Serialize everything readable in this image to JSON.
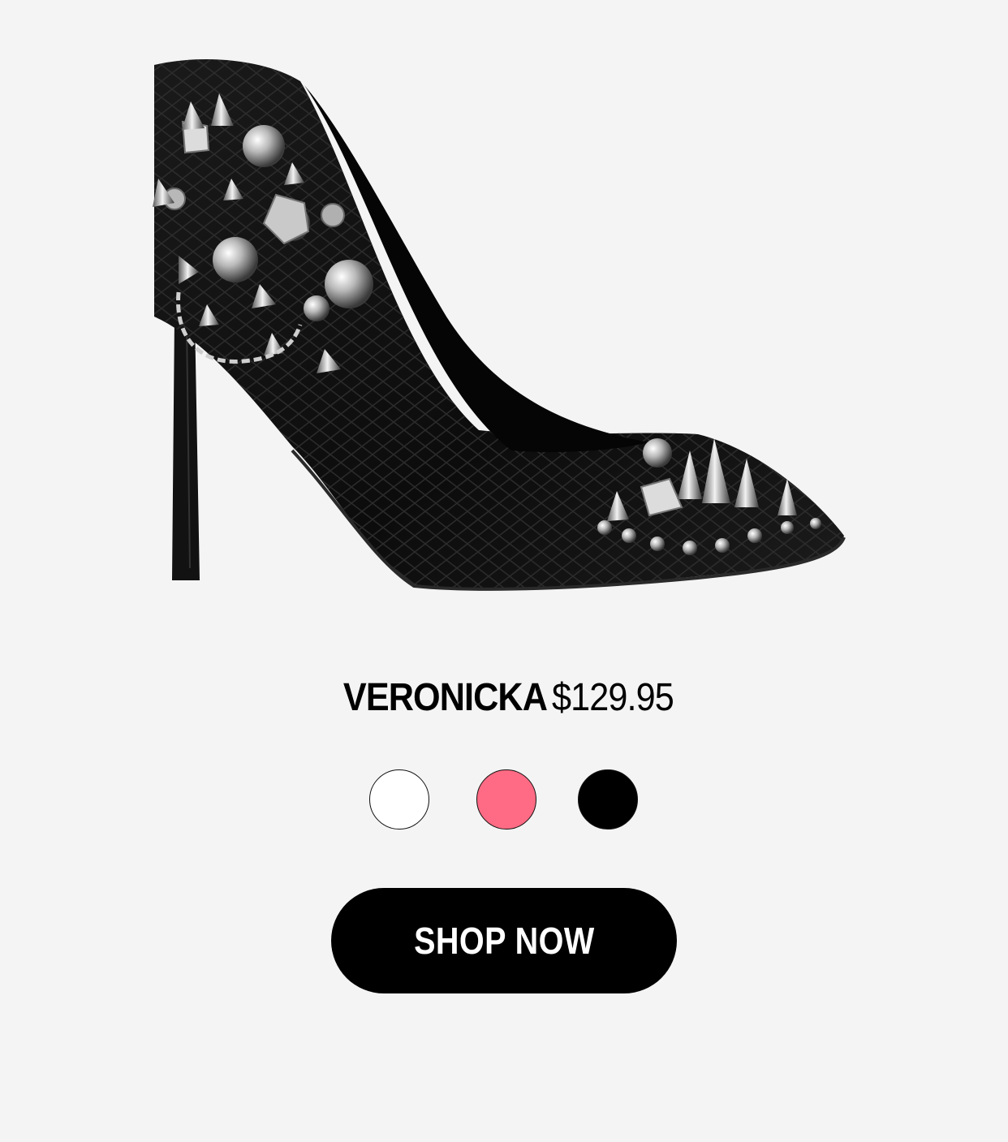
{
  "product": {
    "name": "VERONICKA",
    "price": "$129.95",
    "image_alt": "Black croc-embossed pointed-toe stiletto pump with silver spikes, studs, crystals and chain"
  },
  "swatches": [
    {
      "label": "white",
      "color": "#ffffff"
    },
    {
      "label": "pink",
      "color": "#ff6b84"
    },
    {
      "label": "black",
      "color": "#000000"
    }
  ],
  "cta": {
    "label": "SHOP NOW"
  }
}
